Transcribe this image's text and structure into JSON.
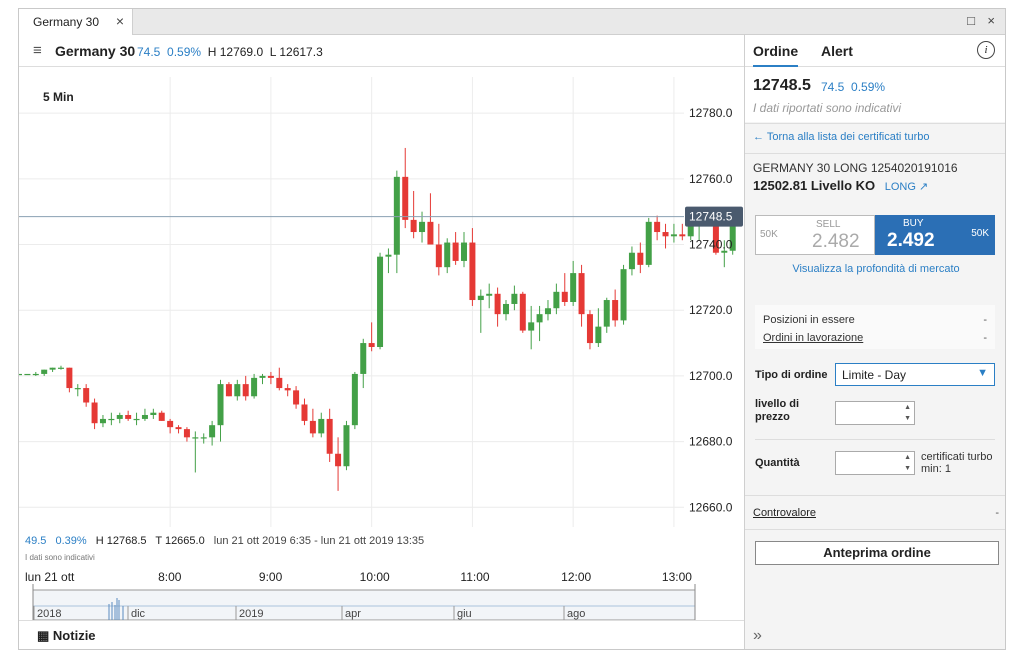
{
  "window": {
    "tab_label": "Germany 30",
    "close": "×",
    "restore": "□"
  },
  "header": {
    "menu_icon": "≡",
    "instrument": "Germany 30",
    "change": "74.5",
    "change_pct": "0.59%",
    "high": "H 12769.0",
    "low": "L 12617.3"
  },
  "chart": {
    "interval": "5 Min",
    "current_price_tag": "12748.5",
    "summary_change": "49.5",
    "summary_pct": "0.39%",
    "summary_high": "H 12768.5",
    "summary_t": "T 12665.0",
    "summary_range": "lun 21 ott 2019 6:35 - lun 21 ott 2019 13:35",
    "disclaimer": "I dati sono indicativi",
    "date_label": "lun 21 ott",
    "navigator_labels": [
      "2018",
      "dic",
      "2019",
      "apr",
      "giu",
      "ago"
    ]
  },
  "chart_data": {
    "type": "candlestick",
    "y_ticks": [
      "12780.0",
      "12760.0",
      "12740.0",
      "12720.0",
      "12700.0",
      "12680.0",
      "12660.0"
    ],
    "y_tick_values": [
      12780,
      12760,
      12740,
      12720,
      12700,
      12680,
      12660
    ],
    "x_ticks": [
      "8:00",
      "9:00",
      "10:00",
      "11:00",
      "12:00",
      "13:00"
    ],
    "x_tick_hours": [
      8,
      9,
      10,
      11,
      12,
      13
    ],
    "x_range_hours": [
      6.5,
      13.1
    ],
    "ylim": [
      12654,
      12791
    ],
    "last_price": 12748.5,
    "candles": [
      {
        "o": 12700.6,
        "h": 12700.6,
        "l": 12700.6,
        "c": 12700.6
      },
      {
        "o": 12700.6,
        "h": 12700.6,
        "l": 12700.6,
        "c": 12700.6
      },
      {
        "o": 12700.6,
        "h": 12701.2,
        "l": 12700.0,
        "c": 12700.6
      },
      {
        "o": 12700.6,
        "h": 12701.9,
        "l": 12700.0,
        "c": 12701.9
      },
      {
        "o": 12701.9,
        "h": 12702.5,
        "l": 12701.2,
        "c": 12702.5
      },
      {
        "o": 12702.5,
        "h": 12703.1,
        "l": 12701.9,
        "c": 12702.5
      },
      {
        "o": 12702.5,
        "h": 12702.5,
        "l": 12695.0,
        "c": 12696.3
      },
      {
        "o": 12696.3,
        "h": 12697.5,
        "l": 12693.8,
        "c": 12696.3
      },
      {
        "o": 12696.3,
        "h": 12697.5,
        "l": 12690.6,
        "c": 12691.9
      },
      {
        "o": 12691.9,
        "h": 12693.1,
        "l": 12683.8,
        "c": 12685.6
      },
      {
        "o": 12685.6,
        "h": 12688.1,
        "l": 12684.4,
        "c": 12686.9
      },
      {
        "o": 12686.9,
        "h": 12688.8,
        "l": 12685.0,
        "c": 12686.9
      },
      {
        "o": 12686.9,
        "h": 12688.8,
        "l": 12685.6,
        "c": 12688.1
      },
      {
        "o": 12688.1,
        "h": 12689.4,
        "l": 12686.3,
        "c": 12686.9
      },
      {
        "o": 12686.9,
        "h": 12688.8,
        "l": 12685.0,
        "c": 12686.9
      },
      {
        "o": 12686.9,
        "h": 12690.0,
        "l": 12686.3,
        "c": 12688.1
      },
      {
        "o": 12688.1,
        "h": 12690.0,
        "l": 12686.9,
        "c": 12688.8
      },
      {
        "o": 12688.8,
        "h": 12689.4,
        "l": 12686.3,
        "c": 12686.3
      },
      {
        "o": 12686.3,
        "h": 12686.9,
        "l": 12682.5,
        "c": 12684.4
      },
      {
        "o": 12684.4,
        "h": 12685.0,
        "l": 12682.5,
        "c": 12683.8
      },
      {
        "o": 12683.8,
        "h": 12684.4,
        "l": 12680.0,
        "c": 12681.3
      },
      {
        "o": 12681.3,
        "h": 12683.1,
        "l": 12670.6,
        "c": 12681.3
      },
      {
        "o": 12681.3,
        "h": 12682.5,
        "l": 12679.4,
        "c": 12681.3
      },
      {
        "o": 12681.3,
        "h": 12686.3,
        "l": 12678.8,
        "c": 12685.0
      },
      {
        "o": 12685.0,
        "h": 12698.8,
        "l": 12680.0,
        "c": 12697.5
      },
      {
        "o": 12697.5,
        "h": 12698.1,
        "l": 12693.8,
        "c": 12693.8
      },
      {
        "o": 12693.8,
        "h": 12698.8,
        "l": 12692.5,
        "c": 12697.5
      },
      {
        "o": 12697.5,
        "h": 12700.0,
        "l": 12692.5,
        "c": 12693.8
      },
      {
        "o": 12693.8,
        "h": 12700.6,
        "l": 12693.1,
        "c": 12699.4
      },
      {
        "o": 12699.4,
        "h": 12700.6,
        "l": 12697.5,
        "c": 12700.0
      },
      {
        "o": 12700.0,
        "h": 12701.2,
        "l": 12697.5,
        "c": 12699.4
      },
      {
        "o": 12699.4,
        "h": 12702.5,
        "l": 12695.6,
        "c": 12696.3
      },
      {
        "o": 12696.3,
        "h": 12697.5,
        "l": 12693.8,
        "c": 12695.6
      },
      {
        "o": 12695.6,
        "h": 12696.9,
        "l": 12690.0,
        "c": 12691.3
      },
      {
        "o": 12691.3,
        "h": 12693.1,
        "l": 12685.0,
        "c": 12686.3
      },
      {
        "o": 12686.3,
        "h": 12690.0,
        "l": 12681.3,
        "c": 12682.5
      },
      {
        "o": 12682.5,
        "h": 12688.8,
        "l": 12681.3,
        "c": 12686.9
      },
      {
        "o": 12686.9,
        "h": 12690.0,
        "l": 12673.8,
        "c": 12676.3
      },
      {
        "o": 12676.3,
        "h": 12681.3,
        "l": 12665.0,
        "c": 12672.5
      },
      {
        "o": 12672.5,
        "h": 12686.3,
        "l": 12671.3,
        "c": 12685.0
      },
      {
        "o": 12685.0,
        "h": 12701.2,
        "l": 12683.8,
        "c": 12700.6
      },
      {
        "o": 12700.6,
        "h": 12711.3,
        "l": 12696.3,
        "c": 12710.0
      },
      {
        "o": 12710.0,
        "h": 12716.3,
        "l": 12707.5,
        "c": 12708.8
      },
      {
        "o": 12708.8,
        "h": 12737.5,
        "l": 12708.1,
        "c": 12736.3
      },
      {
        "o": 12736.3,
        "h": 12738.8,
        "l": 12731.3,
        "c": 12736.9
      },
      {
        "o": 12736.9,
        "h": 12762.5,
        "l": 12731.3,
        "c": 12760.6
      },
      {
        "o": 12760.6,
        "h": 12769.4,
        "l": 12745.0,
        "c": 12747.5
      },
      {
        "o": 12747.5,
        "h": 12756.3,
        "l": 12741.9,
        "c": 12743.8
      },
      {
        "o": 12743.8,
        "h": 12750.0,
        "l": 12740.6,
        "c": 12746.9
      },
      {
        "o": 12746.9,
        "h": 12755.6,
        "l": 12740.0,
        "c": 12740.0
      },
      {
        "o": 12740.0,
        "h": 12746.3,
        "l": 12730.6,
        "c": 12733.1
      },
      {
        "o": 12733.1,
        "h": 12741.9,
        "l": 12731.3,
        "c": 12740.6
      },
      {
        "o": 12740.6,
        "h": 12743.8,
        "l": 12733.8,
        "c": 12735.0
      },
      {
        "o": 12735.0,
        "h": 12743.8,
        "l": 12733.1,
        "c": 12740.6
      },
      {
        "o": 12740.6,
        "h": 12745.0,
        "l": 12721.3,
        "c": 12723.1
      },
      {
        "o": 12723.1,
        "h": 12726.3,
        "l": 12713.1,
        "c": 12724.4
      },
      {
        "o": 12724.4,
        "h": 12728.1,
        "l": 12720.6,
        "c": 12725.0
      },
      {
        "o": 12725.0,
        "h": 12726.9,
        "l": 12715.0,
        "c": 12718.8
      },
      {
        "o": 12718.8,
        "h": 12723.1,
        "l": 12716.9,
        "c": 12721.9
      },
      {
        "o": 12721.9,
        "h": 12727.5,
        "l": 12720.0,
        "c": 12725.0
      },
      {
        "o": 12725.0,
        "h": 12725.6,
        "l": 12713.1,
        "c": 12713.8
      },
      {
        "o": 12713.8,
        "h": 12721.3,
        "l": 12708.1,
        "c": 12716.3
      },
      {
        "o": 12716.3,
        "h": 12721.3,
        "l": 12710.6,
        "c": 12718.8
      },
      {
        "o": 12718.8,
        "h": 12723.1,
        "l": 12716.9,
        "c": 12720.6
      },
      {
        "o": 12720.6,
        "h": 12728.1,
        "l": 12718.8,
        "c": 12725.6
      },
      {
        "o": 12725.6,
        "h": 12731.3,
        "l": 12721.3,
        "c": 12722.5
      },
      {
        "o": 12722.5,
        "h": 12735.0,
        "l": 12721.3,
        "c": 12731.3
      },
      {
        "o": 12731.3,
        "h": 12733.8,
        "l": 12715.0,
        "c": 12718.8
      },
      {
        "o": 12718.8,
        "h": 12720.0,
        "l": 12708.1,
        "c": 12710.0
      },
      {
        "o": 12710.0,
        "h": 12720.6,
        "l": 12708.8,
        "c": 12715.0
      },
      {
        "o": 12715.0,
        "h": 12723.8,
        "l": 12713.1,
        "c": 12723.1
      },
      {
        "o": 12723.1,
        "h": 12726.3,
        "l": 12715.0,
        "c": 12716.9
      },
      {
        "o": 12716.9,
        "h": 12733.8,
        "l": 12715.6,
        "c": 12732.5
      },
      {
        "o": 12732.5,
        "h": 12739.4,
        "l": 12730.6,
        "c": 12737.5
      },
      {
        "o": 12737.5,
        "h": 12740.6,
        "l": 12731.3,
        "c": 12733.8
      },
      {
        "o": 12733.8,
        "h": 12748.1,
        "l": 12733.1,
        "c": 12746.9
      },
      {
        "o": 12746.9,
        "h": 12748.8,
        "l": 12741.3,
        "c": 12743.8
      },
      {
        "o": 12743.8,
        "h": 12746.3,
        "l": 12738.8,
        "c": 12742.5
      },
      {
        "o": 12742.5,
        "h": 12746.3,
        "l": 12740.6,
        "c": 12743.1
      },
      {
        "o": 12743.1,
        "h": 12746.3,
        "l": 12741.3,
        "c": 12742.5
      },
      {
        "o": 12742.5,
        "h": 12748.8,
        "l": 12741.3,
        "c": 12746.3
      },
      {
        "o": 12746.3,
        "h": 12748.8,
        "l": 12741.3,
        "c": 12746.9
      },
      {
        "o": 12746.9,
        "h": 12751.3,
        "l": 12745.6,
        "c": 12748.1
      },
      {
        "o": 12748.1,
        "h": 12748.8,
        "l": 12736.9,
        "c": 12737.5
      },
      {
        "o": 12737.5,
        "h": 12741.3,
        "l": 12733.1,
        "c": 12738.1
      },
      {
        "o": 12738.1,
        "h": 12749.4,
        "l": 12736.9,
        "c": 12748.8
      }
    ]
  },
  "panel": {
    "tab_order": "Ordine",
    "tab_alert": "Alert",
    "info_icon": "i",
    "price": "12748.5",
    "change": "74.5",
    "change_pct": "0.59%",
    "indicative": "I dati riportati sono indicativi",
    "back_link": "← Torna alla lista dei certificati turbo",
    "product": "GERMANY 30 LONG 1254020191016",
    "ko_level": "12502.81 Livello KO",
    "long_link": "LONG ↗",
    "sell_qty": "50K",
    "sell_label": "SELL",
    "sell_value": "2.482",
    "buy_label": "BUY",
    "buy_value": "2.492",
    "buy_qty": "50K",
    "depth_link": "Visualizza la profondità di mercato",
    "positions": "Posizioni in essere",
    "positions_value": "-",
    "orders": "Ordini in lavorazione",
    "orders_value": "-",
    "order_type_label": "Tipo di ordine",
    "order_type_value": "Limite - Day",
    "price_level_label": "livello di prezzo",
    "price_level_value": "",
    "quantity_label": "Quantità",
    "quantity_value": "",
    "quantity_hint": "certificati turbo min: 1",
    "controvalore": "Controvalore",
    "controvalore_value": "-",
    "preview_button": "Anteprima ordine",
    "expand_icon": "»"
  },
  "news": {
    "icon": "▦",
    "label": "Notizie"
  },
  "colors": {
    "up": "#43a047",
    "down": "#e53935",
    "accent": "#2b7fc5",
    "buy": "#2b6fb5",
    "price_tag": "#4a5a6e"
  }
}
